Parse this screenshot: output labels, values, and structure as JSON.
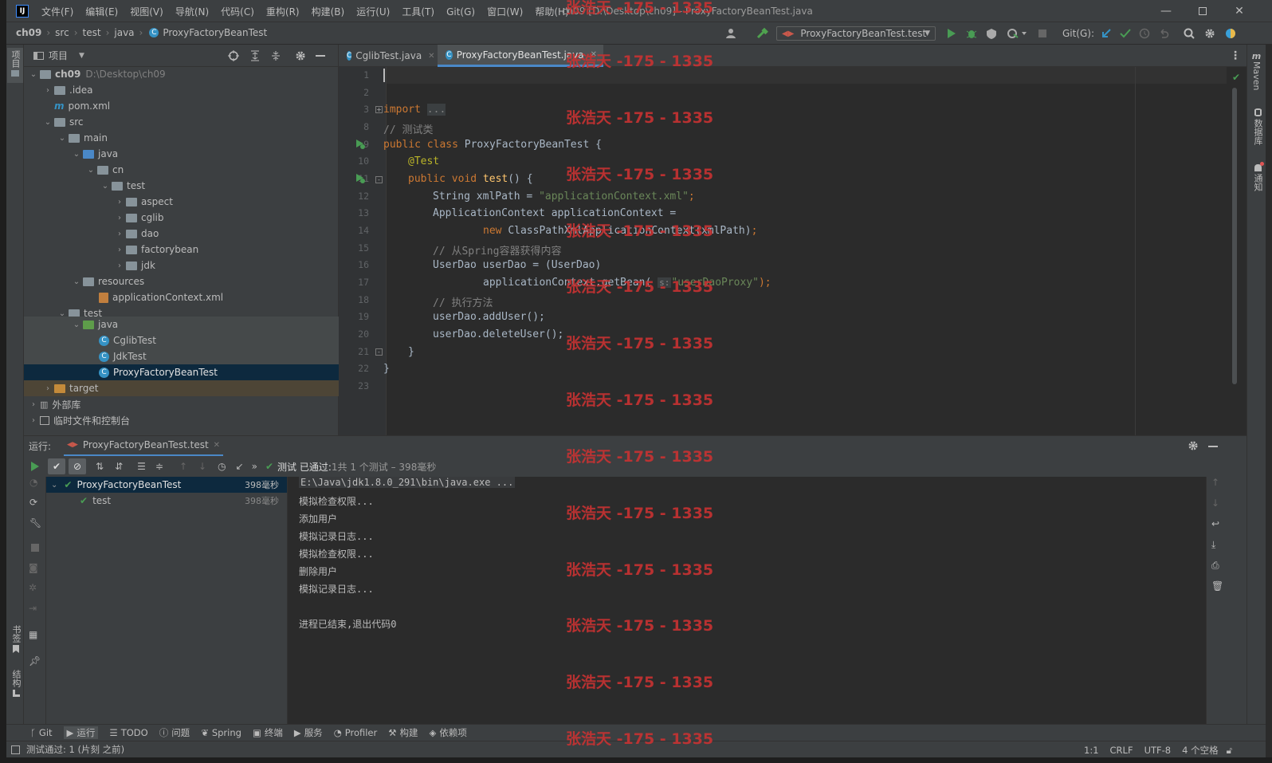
{
  "titlebar": {
    "menu": [
      "文件(F)",
      "编辑(E)",
      "视图(V)",
      "导航(N)",
      "代码(C)",
      "重构(R)",
      "构建(B)",
      "运行(U)",
      "工具(T)",
      "Git(G)",
      "窗口(W)",
      "帮助(H)"
    ],
    "window_title": "ch09 [D:\\Desktop\\ch09] - ProxyFactoryBeanTest.java"
  },
  "navbar": {
    "breadcrumbs": [
      "ch09",
      "src",
      "test",
      "java",
      "ProxyFactoryBeanTest"
    ],
    "run_config": "ProxyFactoryBeanTest.test",
    "git_label": "Git(G):"
  },
  "left_strip": {
    "project_label": "项目",
    "bookmarks_label": "书签",
    "structure_label": "结构"
  },
  "right_strip": {
    "maven_label": "Maven",
    "database_label": "数据库",
    "notifications_label": "通知"
  },
  "project_panel": {
    "title": "项目",
    "tree": [
      {
        "label": "ch09",
        "hint": "D:\\Desktop\\ch09"
      },
      {
        "label": ".idea"
      },
      {
        "label": "pom.xml"
      },
      {
        "label": "src"
      },
      {
        "label": "main"
      },
      {
        "label": "java"
      },
      {
        "label": "cn"
      },
      {
        "label": "test"
      },
      {
        "label": "aspect"
      },
      {
        "label": "cglib"
      },
      {
        "label": "dao"
      },
      {
        "label": "factorybean"
      },
      {
        "label": "jdk"
      },
      {
        "label": "resources"
      },
      {
        "label": "applicationContext.xml"
      },
      {
        "label": "test"
      },
      {
        "label": "java"
      },
      {
        "label": "CglibTest"
      },
      {
        "label": "JdkTest"
      },
      {
        "label": "ProxyFactoryBeanTest"
      },
      {
        "label": "target"
      },
      {
        "label": "外部库"
      },
      {
        "label": "临时文件和控制台"
      }
    ]
  },
  "editor": {
    "tabs": [
      "CglibTest.java",
      "ProxyFactoryBeanTest.java"
    ],
    "line_numbers": [
      "1",
      "2",
      "3",
      "8",
      "9",
      "10",
      "11",
      "12",
      "13",
      "14",
      "15",
      "16",
      "17",
      "18",
      "19",
      "20",
      "21",
      "22",
      "23"
    ],
    "code": {
      "l3_import": "import",
      "l3_dots": "...",
      "l8": "// 测试类",
      "l9_kw": "public class ",
      "l9_rest": "ProxyFactoryBeanTest {",
      "l10": "@Test",
      "l11_kw": "public void ",
      "l11_fn": "test",
      "l11_rest": "() {",
      "l12_a": "String xmlPath = ",
      "l12_str": "\"applicationContext.xml\"",
      "l12_semi": ";",
      "l13": "ApplicationContext applicationContext =",
      "l14_kw": "new ",
      "l14_rest": "ClassPathXmlApplicationContext(xmlPath)",
      "l14_semi": ";",
      "l15": "// 从Spring容器获得内容",
      "l16": "UserDao userDao = (UserDao)",
      "l17_a": "applicationContext.getBean(",
      "l17_hint": "s:",
      "l17_str": "\"userDaoProxy\"",
      "l17_b": ");",
      "l18": "// 执行方法",
      "l19": "userDao.addUser();",
      "l20": "userDao.deleteUser();",
      "l21": "}",
      "l22": "}"
    }
  },
  "run_panel": {
    "label": "运行:",
    "tab": "ProxyFactoryBeanTest.test",
    "status_prefix": "测试 已通过:",
    "status_count": "1共 1 个测试 – 398毫秒",
    "tree": [
      {
        "label": "ProxyFactoryBeanTest",
        "time": "398毫秒"
      },
      {
        "label": "test",
        "time": "398毫秒"
      }
    ],
    "console": [
      "E:\\Java\\jdk1.8.0_291\\bin\\java.exe ...",
      "模拟检查权限...",
      "添加用户",
      "模拟记录日志...",
      "模拟检查权限...",
      "删除用户",
      "模拟记录日志...",
      "",
      "进程已结束,退出代码0"
    ]
  },
  "bottom_tabs": [
    "Git",
    "运行",
    "TODO",
    "问题",
    "Spring",
    "终端",
    "服务",
    "Profiler",
    "构建",
    "依赖项"
  ],
  "statusbar": {
    "message": "测试通过: 1 (片刻 之前)",
    "position": "1:1",
    "line_sep": "CRLF",
    "encoding": "UTF-8",
    "indent": "4 个空格"
  },
  "watermark": "张浩天 -175 - 1335",
  "colors": {
    "accent": "#4a88c7",
    "keyword": "#cc7832",
    "string": "#6a8759",
    "comment": "#808080",
    "annotation": "#bbb529",
    "watermark": "#c83232"
  }
}
